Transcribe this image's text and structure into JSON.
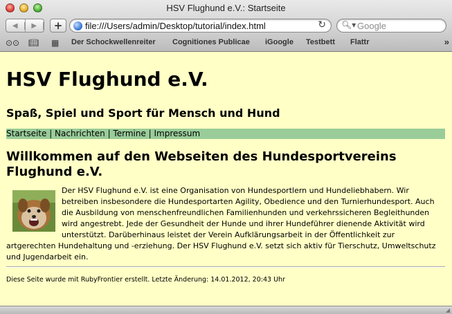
{
  "window": {
    "title": "HSV Flughund e.V.: Startseite"
  },
  "toolbar": {
    "back_icon": "back-arrow-icon",
    "forward_icon": "forward-arrow-icon",
    "add_bookmark_label": "+",
    "url": "file:///Users/admin/Desktop/tutorial/index.html",
    "search_placeholder": "Google"
  },
  "bookmarks": {
    "items": [
      "Der Schockwellenreiter",
      "Cognitiones Publicae",
      "iGoogle",
      "Testbett",
      "Flattr"
    ],
    "more_label": "»"
  },
  "page": {
    "title": "HSV Flughund e.V.",
    "subtitle": "Spaß, Spiel und Sport für Mensch und Hund",
    "nav": [
      "Startseite",
      "Nachrichten",
      "Termine",
      "Impressum"
    ],
    "nav_separator": " | ",
    "heading": "Willkommen auf den Webseiten des Hundesportvereins Flughund e.V.",
    "paragraph": "Der HSV Flughund e.V. ist eine Organisation von Hundesportlern und Hundeliebhabern. Wir betreiben insbesondere die Hundesportarten Agility, Obedience und den Turnierhundesport. Auch die Ausbildung von menschenfreundlichen Familienhunden und verkehrssicheren Begleithunden wird angestrebt. Jede der Gesundheit der Hunde und ihrer Hundeführer dienende Aktivität wird unterstützt. Darüberhinaus leistet der Verein Aufklärungsarbeit in der Öffentlichkeit zur artgerechten Hundehaltung und -erziehung. Der HSV Flughund e.V. setzt sich aktiv für Tierschutz, Umweltschutz und Jugendarbeit ein.",
    "footer": "Diese Seite wurde mit RubyFrontier erstellt. Letzte Änderung: 14.01.2012, 20:43 Uhr"
  },
  "colors": {
    "page_background": "#ffffc6",
    "nav_background": "#99cc99"
  }
}
